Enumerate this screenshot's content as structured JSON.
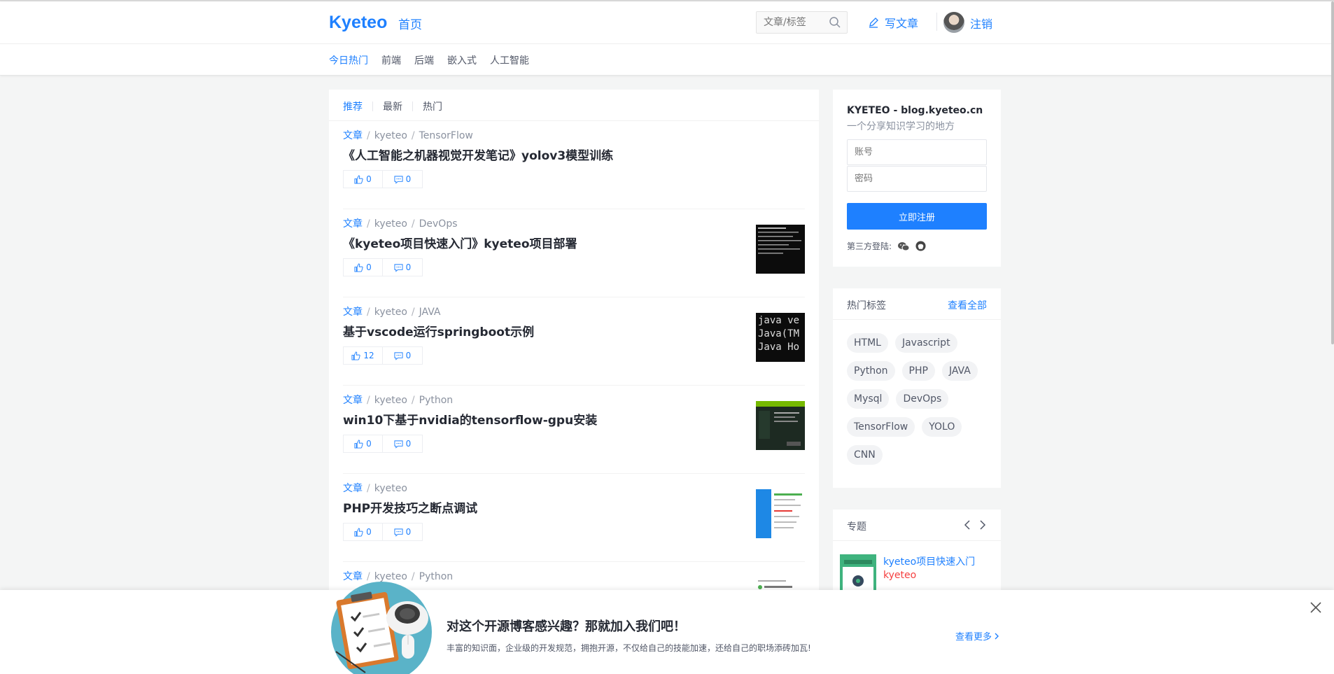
{
  "header": {
    "logo": "Kyeteo",
    "home": "首页",
    "search_placeholder": "文章/标签",
    "write": "写文章",
    "logout": "注销"
  },
  "categories": [
    "今日热门",
    "前端",
    "后端",
    "嵌入式",
    "人工智能"
  ],
  "sort_tabs": [
    "推荐",
    "最新",
    "热门"
  ],
  "articles": [
    {
      "type": "文章",
      "author": "kyeteo",
      "tag": "TensorFlow",
      "title": "《人工智能之机器视觉开发笔记》yolov3模型训练",
      "likes": "0",
      "comments": "0",
      "thumb": "none"
    },
    {
      "type": "文章",
      "author": "kyeteo",
      "tag": "DevOps",
      "title": "《kyeteo项目快速入门》kyeteo项目部署",
      "likes": "0",
      "comments": "0",
      "thumb": "terminal"
    },
    {
      "type": "文章",
      "author": "kyeteo",
      "tag": "JAVA",
      "title": "基于vscode运行springboot示例",
      "likes": "12",
      "comments": "0",
      "thumb": "java"
    },
    {
      "type": "文章",
      "author": "kyeteo",
      "tag": "Python",
      "title": "win10下基于nvidia的tensorflow-gpu安装",
      "likes": "0",
      "comments": "0",
      "thumb": "installer"
    },
    {
      "type": "文章",
      "author": "kyeteo",
      "tag": "",
      "title": "PHP开发技巧之断点调试",
      "likes": "0",
      "comments": "0",
      "thumb": "ide"
    },
    {
      "type": "文章",
      "author": "kyeteo",
      "tag": "Python",
      "title": "",
      "likes": "",
      "comments": "",
      "thumb": "doc"
    }
  ],
  "login": {
    "site_name": "KYETEO - blog.kyeteo.cn",
    "site_desc": "一个分享知识学习的地方",
    "account_placeholder": "账号",
    "password_placeholder": "密码",
    "register_button": "立即注册",
    "third_party": "第三方登陆:"
  },
  "hot_tags": {
    "title": "热门标签",
    "view_all": "查看全部",
    "tags": [
      "HTML",
      "Javascript",
      "Python",
      "PHP",
      "JAVA",
      "Mysql",
      "DevOps",
      "TensorFlow",
      "YOLO",
      "CNN"
    ]
  },
  "topics": {
    "title": "专题",
    "items": [
      {
        "title": "kyeteo项目快速入门",
        "author": "kyeteo"
      }
    ]
  },
  "banner": {
    "title": "对这个开源博客感兴趣？那就加入我们吧！",
    "subtitle": "丰富的知识面，企业级的开发规范，拥抱开源，不仅给自己的技能加速，还给自己的职场添砖加瓦!",
    "more": "查看更多"
  },
  "colors": {
    "accent": "#1e80ff",
    "author_red": "#f53f3f",
    "page_bg": "#f4f5f5"
  }
}
